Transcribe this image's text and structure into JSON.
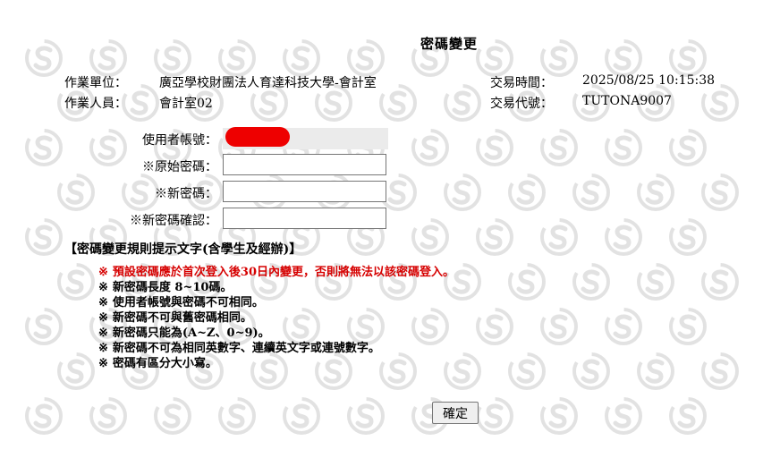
{
  "page": {
    "title": "密碼變更"
  },
  "info": {
    "unit_label": "作業單位：",
    "unit_value": "廣亞學校財團法人育達科技大學-會計室",
    "operator_label": "作業人員：",
    "operator_value": "會計室02",
    "time_label": "交易時間：",
    "time_value": "2025/08/25 10:15:38",
    "code_label": "交易代號：",
    "code_value": "TUTONA9007"
  },
  "form": {
    "account_label": "使用者帳號：",
    "old_password_label": "※原始密碼：",
    "new_password_label": "※新密碼：",
    "confirm_password_label": "※新密碼確認：",
    "old_password_value": "",
    "new_password_value": "",
    "confirm_password_value": ""
  },
  "rules": {
    "title": "【密碼變更規則提示文字(含學生及經辦)】",
    "mark": "※",
    "items": [
      {
        "text": "預設密碼應於首次登入後30日內變更，否則將無法以該密碼登入。",
        "color": "#d60000"
      },
      {
        "text": "新密碼長度 8~10碼。"
      },
      {
        "text": "使用者帳號與密碼不可相同。"
      },
      {
        "text": "新密碼不可與舊密碼相同。"
      },
      {
        "text": "新密碼只能為(A~Z、0~9)。"
      },
      {
        "text": "新密碼不可為相同英數字、連續英文字或連號數字。"
      },
      {
        "text": "密碼有區分大小寫。"
      }
    ]
  },
  "actions": {
    "confirm_label": "確定"
  },
  "colors": {
    "warning": "#d60000",
    "redaction": "#ee0000",
    "watermark": "#000000"
  },
  "icons": {
    "watermark": "dollar-s-logo-icon"
  }
}
